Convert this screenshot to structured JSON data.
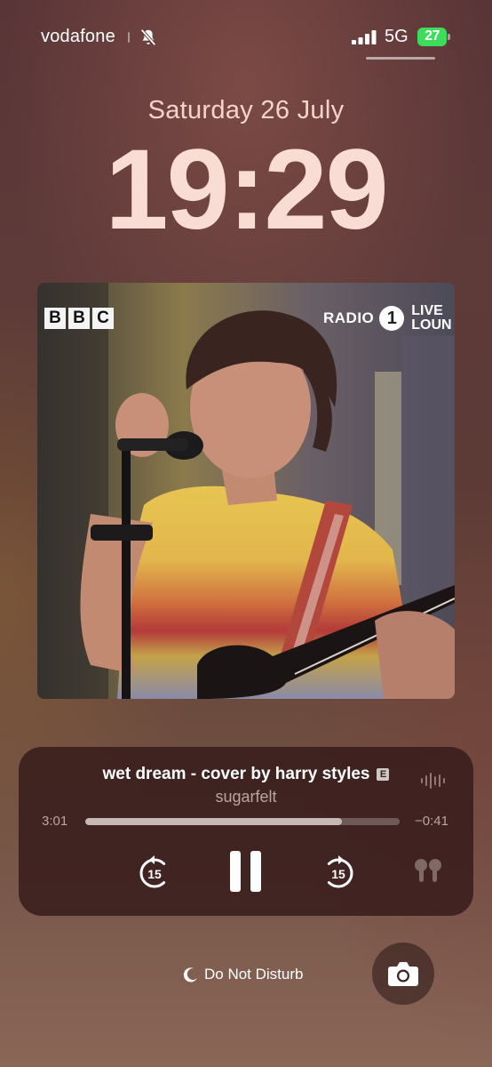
{
  "status_bar": {
    "carrier": "vodafone",
    "network": "5G",
    "battery": "27",
    "icons": [
      "silent-mode-icon",
      "signal-bars-icon",
      "battery-charging-icon"
    ]
  },
  "lock_screen": {
    "date": "Saturday 26 July",
    "time": "19:29"
  },
  "artwork": {
    "bbc_logo": [
      "B",
      "B",
      "C"
    ],
    "radio_text": "RADIO",
    "radio_number": "1",
    "live_lounge": [
      "LIVE",
      "LOUN"
    ]
  },
  "now_playing": {
    "title": "wet dream - cover by harry styles",
    "explicit_badge": "E",
    "artist": "sugarfelt",
    "elapsed": "3:01",
    "remaining": "−0:41",
    "progress": 0.815,
    "skip_back_seconds": "15",
    "skip_forward_seconds": "15",
    "state": "playing"
  },
  "bottom": {
    "focus_label": "Do Not Disturb",
    "focus_icon": "moon-icon",
    "camera_icon": "camera-icon"
  },
  "colors": {
    "battery_green": "#3ddc5a",
    "clock": "#f9ddd5",
    "player_bg": "#341a1a"
  }
}
